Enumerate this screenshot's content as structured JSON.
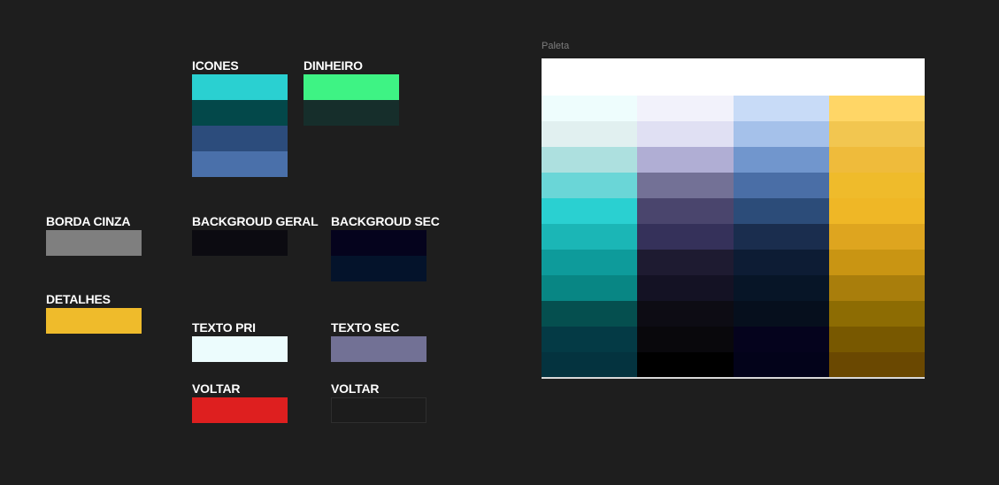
{
  "groups": [
    {
      "id": "icones",
      "label": "ICONES",
      "colors": [
        "#2ad0d1",
        "#03484a",
        "#2c4c7c",
        "#4a70aa"
      ]
    },
    {
      "id": "dinheiro",
      "label": "DINHEIRO",
      "colors": [
        "#3ef384",
        "#162e2b"
      ]
    },
    {
      "id": "borda-cinza",
      "label": "BORDA CINZA",
      "colors": [
        "#7f7f7f"
      ]
    },
    {
      "id": "backgroud-geral",
      "label": "BACKGROUD GERAL",
      "colors": [
        "#0c0b11"
      ]
    },
    {
      "id": "backgroud-sec",
      "label": "BACKGROUD SEC",
      "colors": [
        "#05031d",
        "#04132b"
      ]
    },
    {
      "id": "detalhes",
      "label": "DETALHES",
      "colors": [
        "#efbb2b"
      ]
    },
    {
      "id": "texto-pri",
      "label": "TEXTO PRI",
      "colors": [
        "#ecfcfd"
      ]
    },
    {
      "id": "texto-sec",
      "label": "TEXTO SEC",
      "colors": [
        "#727195"
      ]
    },
    {
      "id": "voltar-red",
      "label": "VOLTAR",
      "colors": [
        "#de1f1f"
      ]
    },
    {
      "id": "voltar-dark",
      "label": "VOLTAR",
      "colors": [
        "#1c1c1c"
      ]
    }
  ],
  "palette": {
    "label": "Paleta",
    "header_color": "#ffffff",
    "columns": [
      [
        "#eefdfd",
        "#e1f0f0",
        "#ade0df",
        "#6ad6d7",
        "#2ad0d1",
        "#1bb6b6",
        "#0e9b9b",
        "#088684",
        "#054f4f",
        "#043a45",
        "#04333f"
      ],
      [
        "#f2f2fb",
        "#e0e0f3",
        "#b0aed4",
        "#737196",
        "#4a456d",
        "#35315a",
        "#1e1b31",
        "#141224",
        "#0d0c14",
        "#09080c",
        "#000000"
      ],
      [
        "#c8dbf7",
        "#a5c1ea",
        "#7196cd",
        "#4a6ea6",
        "#2c4c79",
        "#1a2d4e",
        "#0d1c34",
        "#071527",
        "#060f1d",
        "#05031d",
        "#03031a"
      ],
      [
        "#ffd666",
        "#f2c650",
        "#efbb3b",
        "#efbb2b",
        "#efb726",
        "#dea51f",
        "#c99513",
        "#a97e0c",
        "#8d6c03",
        "#785800",
        "#6a4801"
      ]
    ]
  }
}
